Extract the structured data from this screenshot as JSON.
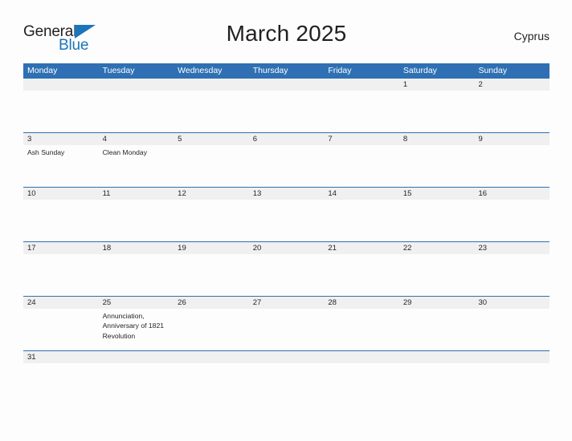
{
  "brand": {
    "word1": "General",
    "word2": "Blue"
  },
  "header": {
    "title": "March 2025",
    "country": "Cyprus"
  },
  "colors": {
    "header_blue": "#2e70b3",
    "brand_blue": "#1b75bb",
    "number_band": "#f0f0f0",
    "page_background": "#fdfdfd",
    "text": "#231f20"
  },
  "calendar": {
    "weekday_headers": [
      "Monday",
      "Tuesday",
      "Wednesday",
      "Thursday",
      "Friday",
      "Saturday",
      "Sunday"
    ],
    "weeks": [
      {
        "numbers": [
          "",
          "",
          "",
          "",
          "",
          "1",
          "2"
        ],
        "events": [
          "",
          "",
          "",
          "",
          "",
          "",
          ""
        ]
      },
      {
        "numbers": [
          "3",
          "4",
          "5",
          "6",
          "7",
          "8",
          "9"
        ],
        "events": [
          "Ash Sunday",
          "Clean Monday",
          "",
          "",
          "",
          "",
          ""
        ]
      },
      {
        "numbers": [
          "10",
          "11",
          "12",
          "13",
          "14",
          "15",
          "16"
        ],
        "events": [
          "",
          "",
          "",
          "",
          "",
          "",
          ""
        ]
      },
      {
        "numbers": [
          "17",
          "18",
          "19",
          "20",
          "21",
          "22",
          "23"
        ],
        "events": [
          "",
          "",
          "",
          "",
          "",
          "",
          ""
        ]
      },
      {
        "numbers": [
          "24",
          "25",
          "26",
          "27",
          "28",
          "29",
          "30"
        ],
        "events": [
          "",
          "Annunciation, Anniversary of 1821 Revolution",
          "",
          "",
          "",
          "",
          ""
        ]
      },
      {
        "numbers": [
          "31",
          "",
          "",
          "",
          "",
          "",
          ""
        ],
        "events": [
          "",
          "",
          "",
          "",
          "",
          "",
          ""
        ]
      }
    ]
  }
}
